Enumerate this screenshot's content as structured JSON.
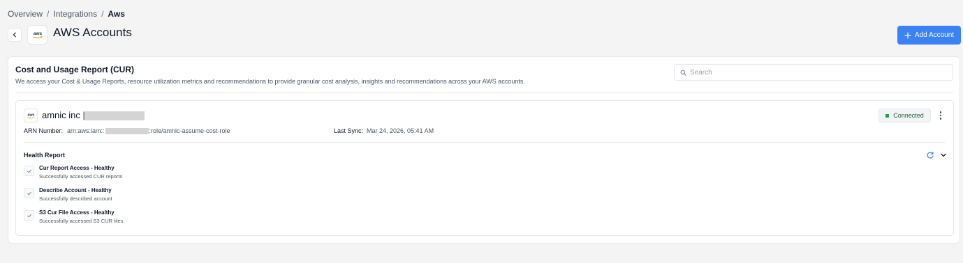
{
  "breadcrumb": {
    "items": [
      "Overview",
      "Integrations",
      "Aws"
    ],
    "separator": "/"
  },
  "header": {
    "title": "AWS Accounts",
    "logo_text": "aws",
    "add_button_label": "Add Account"
  },
  "cur_section": {
    "title": "Cost and Usage Report (CUR)",
    "description": "We access your Cost & Usage Reports, resource utilization metrics and recommendations to provide granular cost analysis, insights and recommendations across your AWS accounts.",
    "search_placeholder": "Search"
  },
  "account": {
    "name": "amnic inc |",
    "logo_text": "aws",
    "arn_label": "ARN Number:",
    "arn_prefix": "arn:aws:iam::",
    "arn_suffix": ":role/amnic-assume-cost-role",
    "last_sync_label": "Last Sync:",
    "last_sync_value": "Mar 24, 2026, 05:41 AM",
    "status": "Connected",
    "status_color": "#16a34a"
  },
  "health_report": {
    "title": "Health Report",
    "checks": [
      {
        "title": "Cur Report Access - Healthy",
        "subtitle": "Successfully accessed CUR reports"
      },
      {
        "title": "Describe Account - Healthy",
        "subtitle": "Successfully described account"
      },
      {
        "title": "S3 Cur File Access - Healthy",
        "subtitle": "Successfully accessed S3 CUR files"
      }
    ]
  },
  "colors": {
    "accent": "#3b82f6",
    "background": "#f4f4f5"
  },
  "icons": [
    "back-arrow-icon",
    "aws-logo-icon",
    "plus-icon",
    "search-icon",
    "refresh-icon",
    "chevron-down-icon",
    "kebab-menu-icon",
    "check-icon"
  ]
}
